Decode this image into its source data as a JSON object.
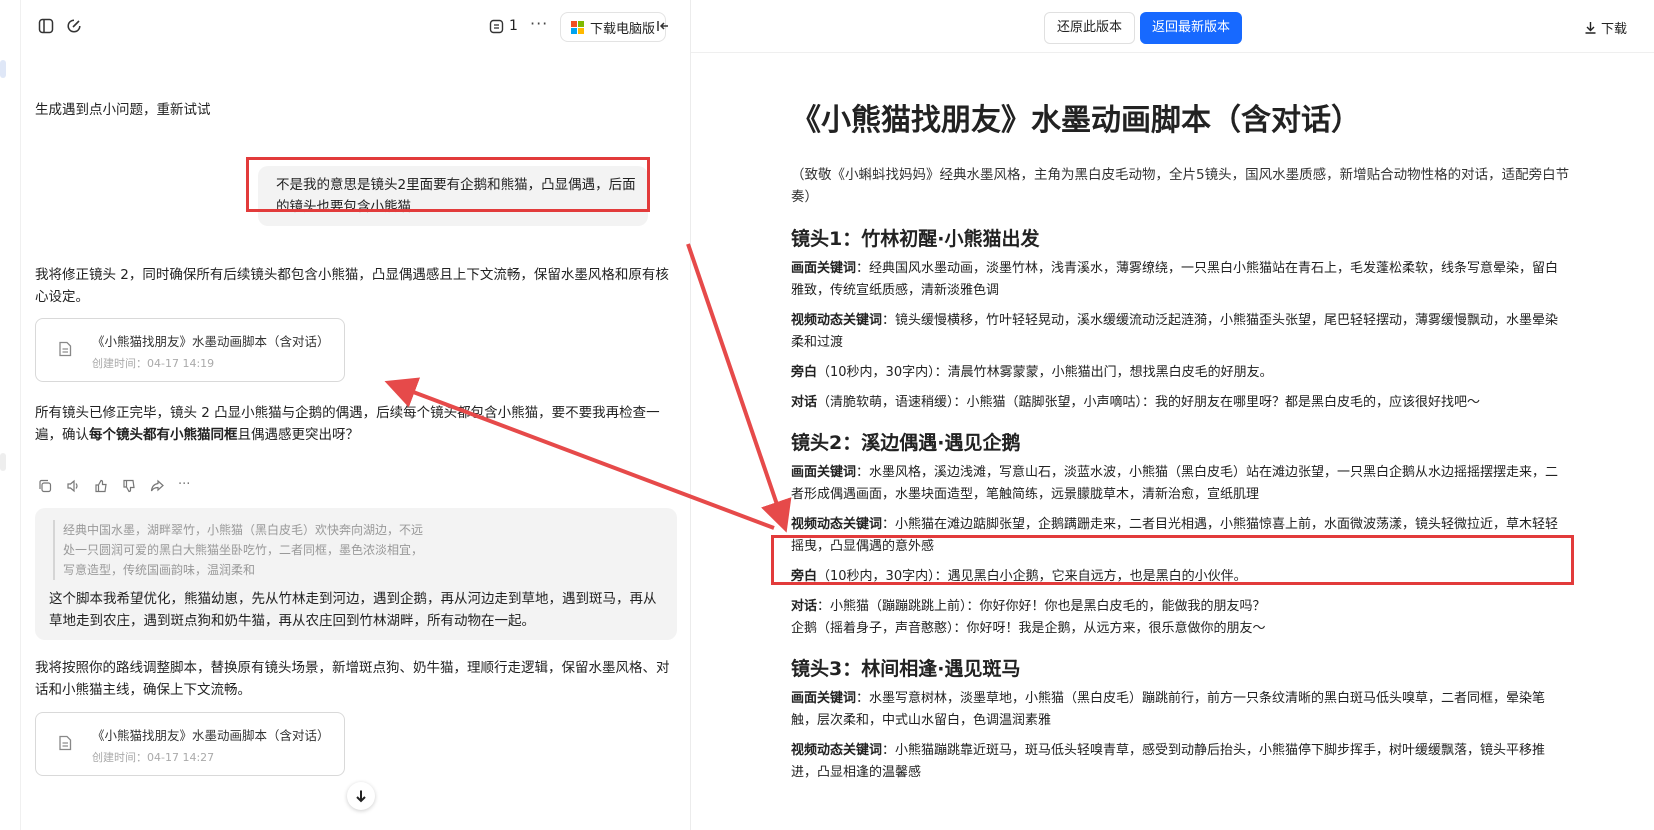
{
  "left_toolbar": {
    "counter": "1",
    "more": "···",
    "download_desktop": "下载电脑版"
  },
  "messages": {
    "ai_error": "生成遇到点小问题，重新试试",
    "user_msg": "不是我的意思是镜头2里面要有企鹅和熊猫，凸显偶遇，后面的镜头也要包含小熊猫",
    "ai_reply1": "我将修正镜头 2，同时确保所有后续镜头都包含小熊猫，凸显偶遇感且上下文流畅，保留水墨风格和原有核心设定。",
    "card1": {
      "title": "《小熊猫找朋友》水墨动画脚本（含对话）",
      "time": "创建时间：04-17 14:19"
    },
    "ai_reply2_pre": "所有镜头已修正完毕，镜头 2 凸显小熊猫与企鹅的偶遇，后续每个镜头都包含小熊猫，要不要我再检查一遍，确认",
    "ai_reply2_bold": "每个镜头都有小熊猫同框",
    "ai_reply2_post": "且偶遇感更突出呀？",
    "quote_lines": [
      "经典中国水墨，湖畔翠竹，小熊猫（黑白皮毛）欢快奔向湖边，不远",
      "处一只圆润可爱的黑白大熊猫坐卧吃竹，二者同框，墨色浓淡相宜，",
      "写意造型，传统国画韵味，温润柔和"
    ],
    "quote_text": "这个脚本我希望优化，熊猫幼崽，先从竹林走到河边，遇到企鹅，再从河边走到草地，遇到斑马，再从草地走到农庄，遇到斑点狗和奶牛猫，再从农庄回到竹林湖畔，所有动物在一起。",
    "ai_reply3": "我将按照你的路线调整脚本，替换原有镜头场景，新增斑点狗、奶牛猫，理顺行走逻辑，保留水墨风格、对话和小熊猫主线，确保上下文流畅。",
    "card2": {
      "title": "《小熊猫找朋友》水墨动画脚本（含对话）",
      "time": "创建时间：04-17 14:27"
    }
  },
  "right_toolbar": {
    "restore": "还原此版本",
    "latest": "返回最新版本",
    "download": "下载"
  },
  "doc": {
    "title": "《小熊猫找朋友》水墨动画脚本（含对话）",
    "intro": "（致敬《小蝌蚪找妈妈》经典水墨风格，主角为黑白皮毛动物，全片5镜头，国风水墨质感，新增贴合动物性格的对话，适配旁白节奏）",
    "shots": [
      {
        "heading": "镜头1：竹林初醒·小熊猫出发",
        "visual_label": "画面关键词",
        "visual": "：经典国风水墨动画，淡墨竹林，浅青溪水，薄雾缭绕，一只黑白小熊猫站在青石上，毛发蓬松柔软，线条写意晕染，留白雅致，传统宣纸质感，清新淡雅色调",
        "motion_label": "视频动态关键词",
        "motion": "：镜头缓慢横移，竹叶轻轻晃动，溪水缓缓流动泛起涟漪，小熊猫歪头张望，尾巴轻轻摆动，薄雾缓慢飘动，水墨晕染柔和过渡",
        "narr_label": "旁白",
        "narr": "（10秒内，30字内）：清晨竹林雾蒙蒙，小熊猫出门，想找黑白皮毛的好朋友。",
        "dialog_label": "对话",
        "dialog": "（清脆软萌，语速稍缓）：小熊猫（踮脚张望，小声嘀咕）：我的好朋友在哪里呀？都是黑白皮毛的，应该很好找吧～"
      },
      {
        "heading": "镜头2：溪边偶遇·遇见企鹅",
        "visual_label": "画面关键词",
        "visual": "：水墨风格，溪边浅滩，写意山石，淡蓝水波，小熊猫（黑白皮毛）站在滩边张望，一只黑白企鹅从水边摇摇摆摆走来，二者形成偶遇画面，水墨块面造型，笔触简练，远景朦胧草木，清新治愈，宣纸肌理",
        "motion_label": "视频动态关键词",
        "motion": "：小熊猫在滩边踮脚张望，企鹅蹒跚走来，二者目光相遇，小熊猫惊喜上前，水面微波荡漾，镜头轻微拉近，草木轻轻摇曳，凸显偶遇的意外感",
        "narr_label": "旁白",
        "narr": "（10秒内，30字内）：遇见黑白小企鹅，它来自远方，也是黑白的小伙伴。",
        "dialog_label": "对话",
        "dialog": "：小熊猫（蹦蹦跳跳上前）：你好你好！你也是黑白皮毛的，能做我的朋友吗？",
        "dialog2": "企鹅（摇着身子，声音憨憨）：你好呀！我是企鹅，从远方来，很乐意做你的朋友～"
      },
      {
        "heading": "镜头3：林间相逢·遇见斑马",
        "visual_label": "画面关键词",
        "visual": "：水墨写意树林，淡墨草地，小熊猫（黑白皮毛）蹦跳前行，前方一只条纹清晰的黑白斑马低头嗅草，二者同框，晕染笔触，层次柔和，中式山水留白，色调温润素雅",
        "motion_label": "视频动态关键词",
        "motion": "：小熊猫蹦跳靠近斑马，斑马低头轻嗅青草，感受到动静后抬头，小熊猫停下脚步挥手，树叶缓缓飘落，镜头平移推进，凸显相逢的温馨感"
      }
    ]
  }
}
